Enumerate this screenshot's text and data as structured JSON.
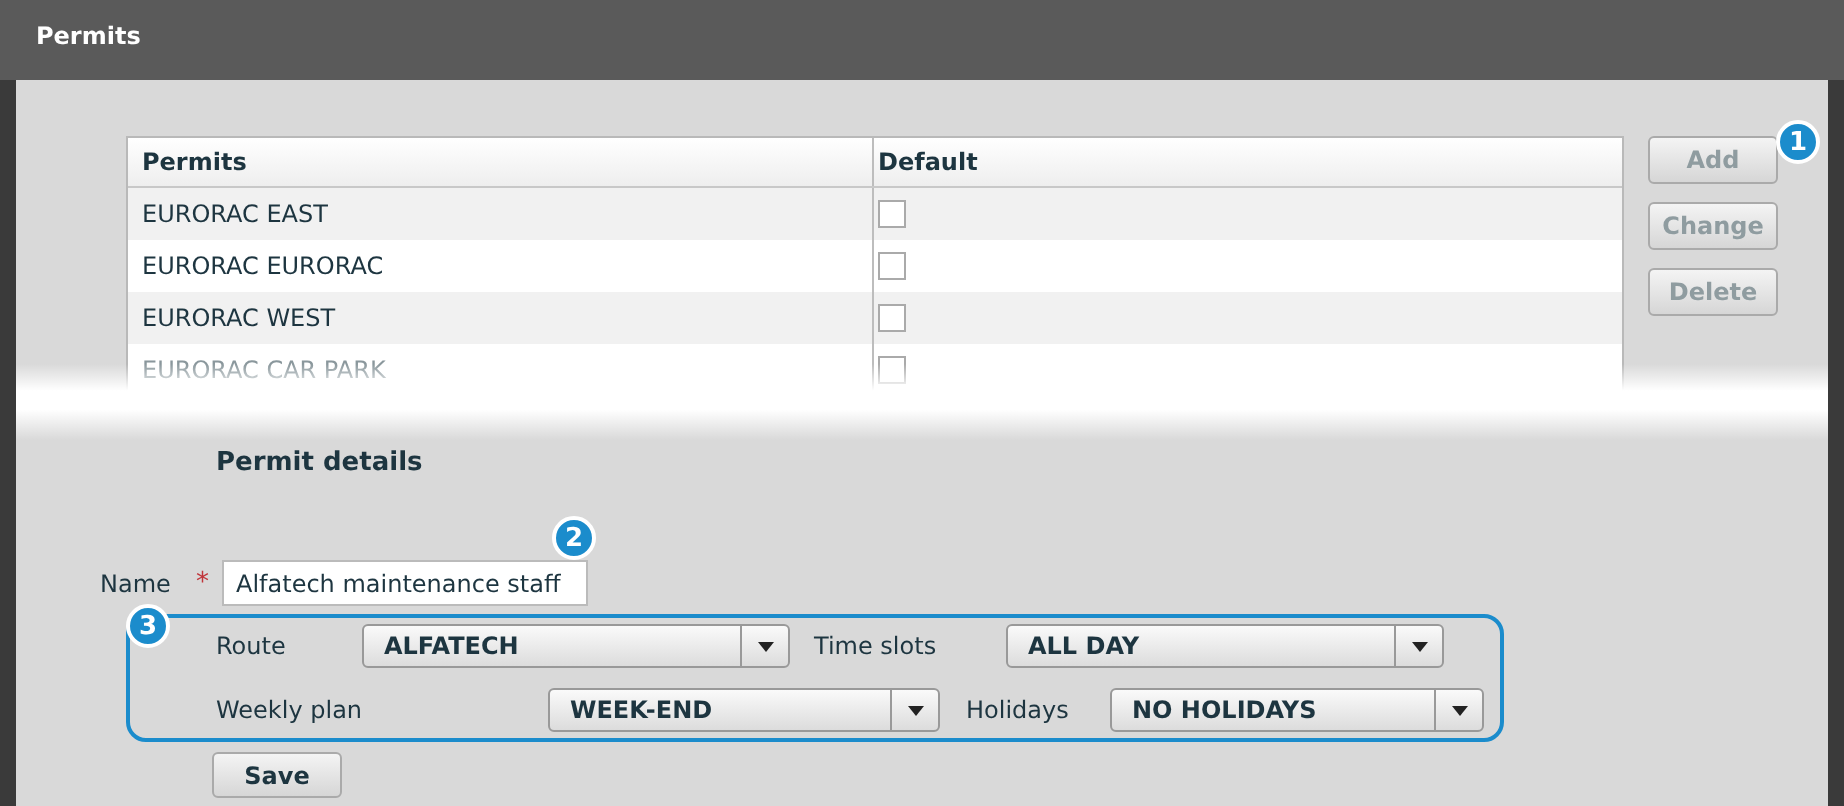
{
  "window": {
    "title": "Permits"
  },
  "table": {
    "columns": [
      "Permits",
      "Default"
    ],
    "rows": [
      {
        "name": "EURORAC EAST",
        "default": false
      },
      {
        "name": "EURORAC EURORAC",
        "default": false
      },
      {
        "name": "EURORAC WEST",
        "default": false
      },
      {
        "name": "EURORAC CAR PARK",
        "default": false
      }
    ]
  },
  "buttons": [
    {
      "label": "Add",
      "disabled": true
    },
    {
      "label": "Change",
      "disabled": true
    },
    {
      "label": "Delete",
      "disabled": true
    }
  ],
  "details": {
    "heading": "Permit details",
    "name_label": "Name",
    "required_mark": "*",
    "name_value": "Alfatech maintenance staff",
    "dropdown_rows": [
      [
        {
          "label": "Route",
          "value": "ALFATECH"
        },
        {
          "label": "Time slots",
          "value": "ALL DAY"
        }
      ],
      [
        {
          "label": "Weekly plan",
          "value": "WEEK-END"
        },
        {
          "label": "Holidays",
          "value": "NO HOLIDAYS"
        }
      ]
    ],
    "save": "Save"
  },
  "callouts": [
    "1",
    "2",
    "3"
  ]
}
